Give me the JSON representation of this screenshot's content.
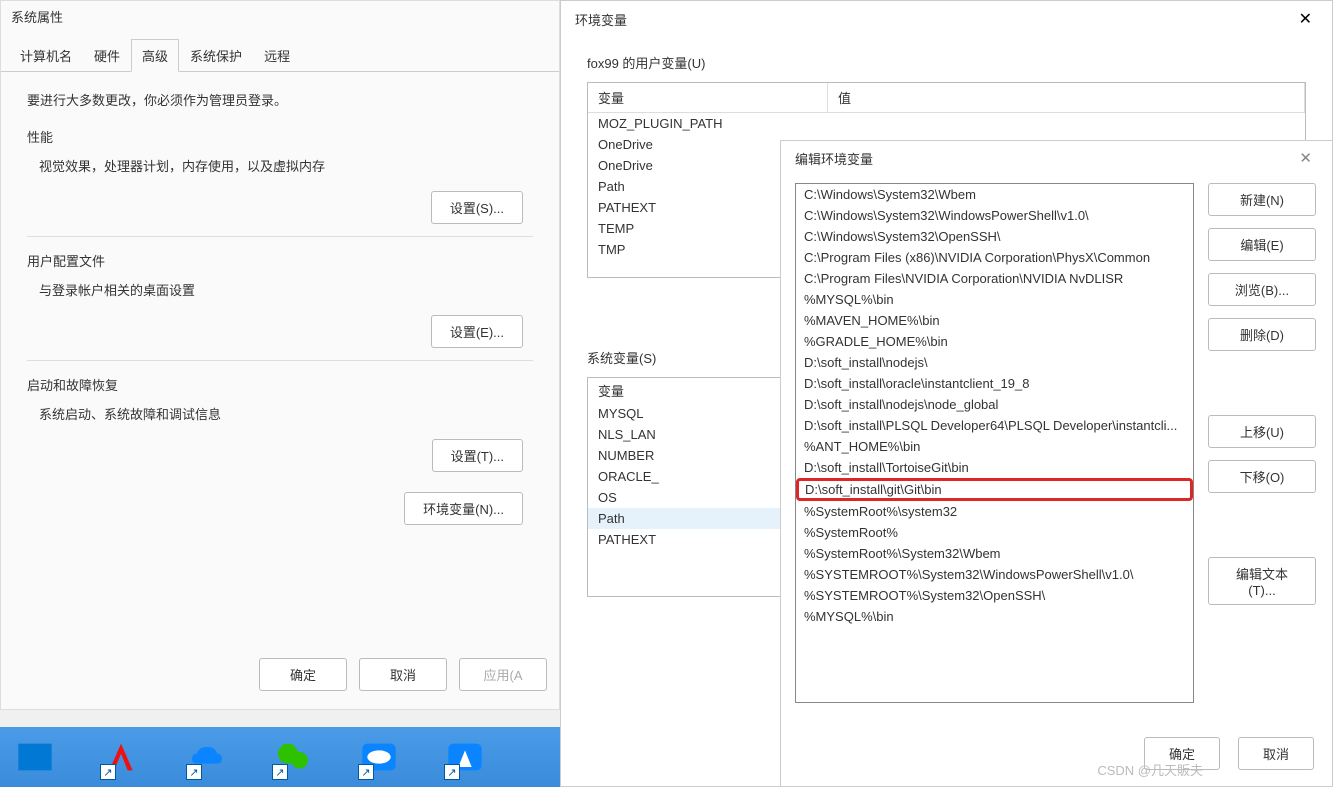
{
  "sysProps": {
    "title": "系统属性",
    "tabs": [
      "计算机名",
      "硬件",
      "高级",
      "系统保护",
      "远程"
    ],
    "activeTab": 2,
    "adminNote": "要进行大多数更改，你必须作为管理员登录。",
    "perf": {
      "title": "性能",
      "desc": "视觉效果，处理器计划，内存使用，以及虚拟内存",
      "btn": "设置(S)..."
    },
    "profile": {
      "title": "用户配置文件",
      "desc": "与登录帐户相关的桌面设置",
      "btn": "设置(E)..."
    },
    "startup": {
      "title": "启动和故障恢复",
      "desc": "系统启动、系统故障和调试信息",
      "btn": "设置(T)..."
    },
    "envBtn": "环境变量(N)...",
    "ok": "确定",
    "cancel": "取消",
    "apply": "应用(A"
  },
  "envDialog": {
    "title": "环境变量",
    "userLabel": "fox99 的用户变量(U)",
    "thVar": "变量",
    "thVal": "值",
    "userVars": [
      {
        "name": "MOZ_PLUGIN_PATH",
        "value": ""
      },
      {
        "name": "OneDrive",
        "value": ""
      },
      {
        "name": "OneDrive",
        "value": ""
      },
      {
        "name": "Path",
        "value": ""
      },
      {
        "name": "PATHEXT",
        "value": ""
      },
      {
        "name": "TEMP",
        "value": ""
      },
      {
        "name": "TMP",
        "value": ""
      }
    ],
    "sysLabel": "系统变量(S)",
    "sysVars": [
      {
        "name": "变量",
        "value": ""
      },
      {
        "name": "MYSQL",
        "value": ""
      },
      {
        "name": "NLS_LAN",
        "value": ""
      },
      {
        "name": "NUMBER",
        "value": ""
      },
      {
        "name": "ORACLE_",
        "value": ""
      },
      {
        "name": "OS",
        "value": ""
      },
      {
        "name": "Path",
        "value": ""
      },
      {
        "name": "PATHEXT",
        "value": ""
      }
    ]
  },
  "editDialog": {
    "title": "编辑环境变量",
    "paths": [
      "C:\\Windows\\System32\\Wbem",
      "C:\\Windows\\System32\\WindowsPowerShell\\v1.0\\",
      "C:\\Windows\\System32\\OpenSSH\\",
      "C:\\Program Files (x86)\\NVIDIA Corporation\\PhysX\\Common",
      "C:\\Program Files\\NVIDIA Corporation\\NVIDIA NvDLISR",
      "%MYSQL%\\bin",
      "%MAVEN_HOME%\\bin",
      "%GRADLE_HOME%\\bin",
      "D:\\soft_install\\nodejs\\",
      "D:\\soft_install\\oracle\\instantclient_19_8",
      "D:\\soft_install\\nodejs\\node_global",
      "D:\\soft_install\\PLSQL Developer64\\PLSQL Developer\\instantcli...",
      "%ANT_HOME%\\bin",
      "D:\\soft_install\\TortoiseGit\\bin",
      "D:\\soft_install\\git\\Git\\bin",
      "%SystemRoot%\\system32",
      "%SystemRoot%",
      "%SystemRoot%\\System32\\Wbem",
      "%SYSTEMROOT%\\System32\\WindowsPowerShell\\v1.0\\",
      "%SYSTEMROOT%\\System32\\OpenSSH\\",
      "%MYSQL%\\bin"
    ],
    "highlightedIndex": 14,
    "buttons": {
      "new": "新建(N)",
      "edit": "编辑(E)",
      "browse": "浏览(B)...",
      "delete": "删除(D)",
      "moveUp": "上移(U)",
      "moveDown": "下移(O)",
      "editText": "编辑文本(T)..."
    },
    "ok": "确定",
    "cancel": "取消"
  },
  "watermark": "CSDN @几天販夫"
}
